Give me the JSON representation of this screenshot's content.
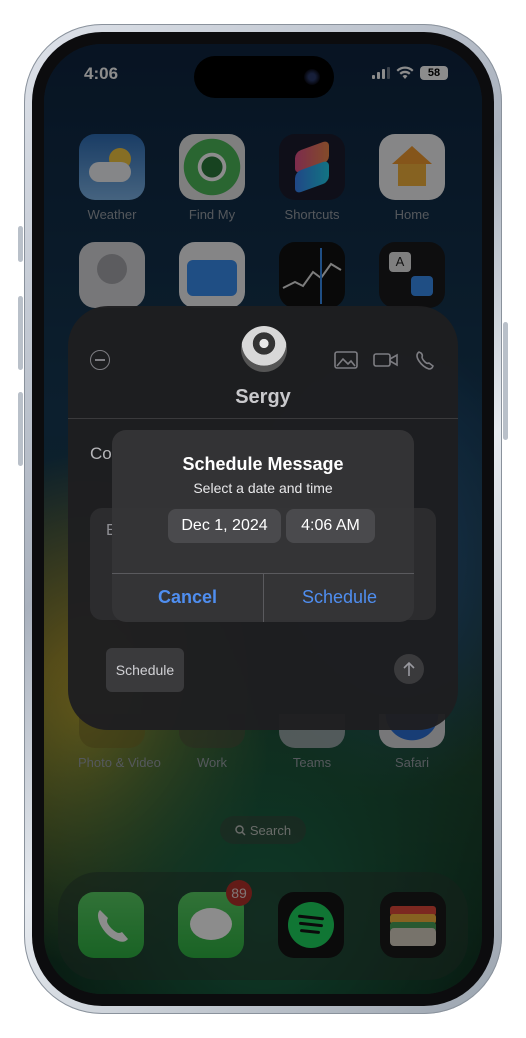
{
  "status_bar": {
    "time": "4:06",
    "battery": "58"
  },
  "apps_row1": [
    {
      "label": "Weather",
      "icon": "weather-icon"
    },
    {
      "label": "Find My",
      "icon": "find-my-icon"
    },
    {
      "label": "Shortcuts",
      "icon": "shortcuts-icon"
    },
    {
      "label": "Home",
      "icon": "home-icon"
    }
  ],
  "apps_row3": [
    {
      "label": "Photo & Video"
    },
    {
      "label": "Work"
    },
    {
      "label": "Teams"
    },
    {
      "label": "Safari"
    }
  ],
  "search": {
    "label": "Search"
  },
  "dock": {
    "messages_badge": "89"
  },
  "contact_card": {
    "name": "Sergy",
    "partial_text": "Co",
    "field_partial": "E",
    "schedule_chip": "Schedule"
  },
  "alert": {
    "title": "Schedule Message",
    "subtitle": "Select a date and time",
    "date": "Dec 1, 2024",
    "time": "4:06 AM",
    "cancel": "Cancel",
    "confirm": "Schedule"
  },
  "colors": {
    "accent": "#4f8ef0",
    "badge": "#b5322b",
    "alert_bg": "#343436"
  }
}
